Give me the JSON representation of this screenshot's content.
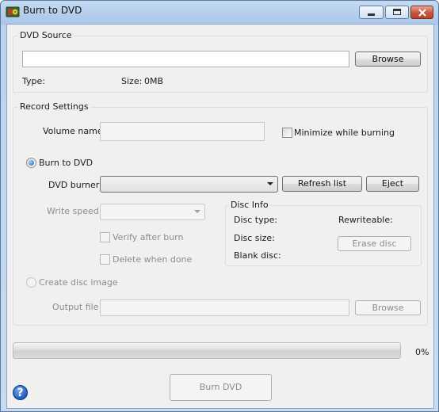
{
  "window": {
    "title": "Burn to DVD"
  },
  "source": {
    "group_label": "DVD Source",
    "path_value": "",
    "browse_label": "Browse",
    "type_label": "Type:",
    "type_value": "",
    "size_label": "Size:",
    "size_value": "0MB"
  },
  "record": {
    "group_label": "Record Settings",
    "volume_name_label": "Volume name",
    "volume_name_value": "",
    "minimize_label": "Minimize while burning",
    "minimize_checked": false,
    "burn_to_dvd_label": "Burn to DVD",
    "burn_to_dvd_selected": true,
    "dvd_burner_label": "DVD burner",
    "dvd_burner_value": "",
    "refresh_label": "Refresh list",
    "eject_label": "Eject",
    "write_speed_label": "Write speed",
    "write_speed_value": "",
    "verify_label": "Verify after burn",
    "delete_label": "Delete when done",
    "create_image_label": "Create disc image",
    "create_image_selected": false,
    "output_file_label": "Output file",
    "output_file_value": "",
    "browse_output_label": "Browse"
  },
  "disc_info": {
    "group_label": "Disc Info",
    "disc_type_label": "Disc type:",
    "rewriteable_label": "Rewriteable:",
    "disc_size_label": "Disc size:",
    "blank_disc_label": "Blank disc:",
    "erase_label": "Erase disc"
  },
  "progress": {
    "percent": 0,
    "percent_label": "0%"
  },
  "footer": {
    "burn_label": "Burn DVD",
    "help_icon": "help-icon",
    "help_glyph": "?"
  },
  "colors": {
    "titlebar": "#b9d1ea",
    "close_button": "#c8553c",
    "accent": "#1d5bbf"
  }
}
